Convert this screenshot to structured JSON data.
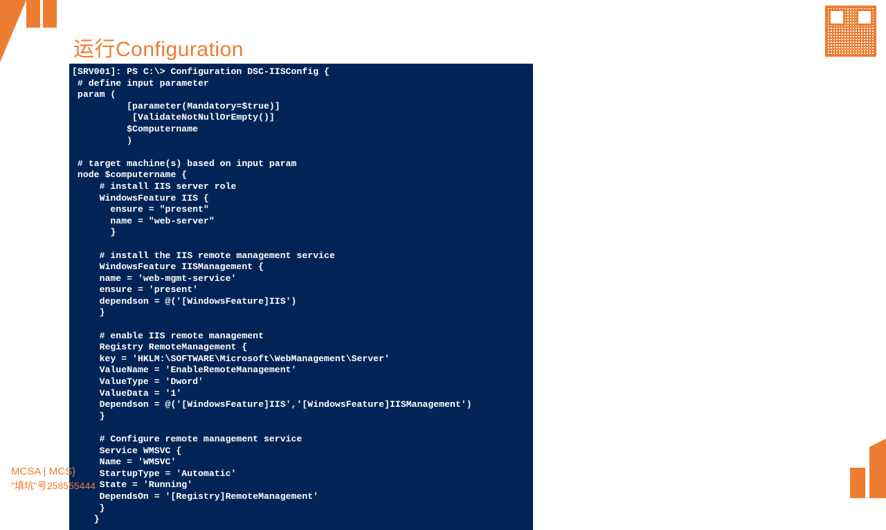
{
  "title": "运行Configuration",
  "footer": {
    "line1": "MCSA | MCS}",
    "line2": "\"填坑\"号258555444"
  },
  "console": {
    "lines": [
      "[SRV001]: PS C:\\> Configuration DSC-IISConfig {",
      " # define input parameter",
      " param (",
      "          [parameter(Mandatory=$true)]",
      "           [ValidateNotNullOrEmpty()]",
      "          $Computername",
      "          )",
      "",
      " # target machine(s) based on input param",
      " node $computername {",
      "     # install IIS server role",
      "     WindowsFeature IIS {",
      "       ensure = \"present\"",
      "       name = \"web-server\"",
      "       }",
      "",
      "     # install the IIS remote management service",
      "     WindowsFeature IISManagement {",
      "     name = 'web-mgmt-service'",
      "     ensure = 'present'",
      "     dependson = @('[WindowsFeature]IIS')",
      "     }",
      "",
      "     # enable IIS remote management",
      "     Registry RemoteManagement {",
      "     key = 'HKLM:\\SOFTWARE\\Microsoft\\WebManagement\\Server'",
      "     ValueName = 'EnableRemoteManagement'",
      "     ValueType = 'Dword'",
      "     ValueData = '1'",
      "     Dependson = @('[WindowsFeature]IIS','[WindowsFeature]IISManagement')",
      "     }",
      "",
      "     # Configure remote management service",
      "     Service WMSVC {",
      "     Name = 'WMSVC'",
      "     StartupType = 'Automatic'",
      "     State = 'Running'",
      "     DependsOn = '[Registry]RemoteManagement'",
      "     }",
      "    }"
    ]
  }
}
